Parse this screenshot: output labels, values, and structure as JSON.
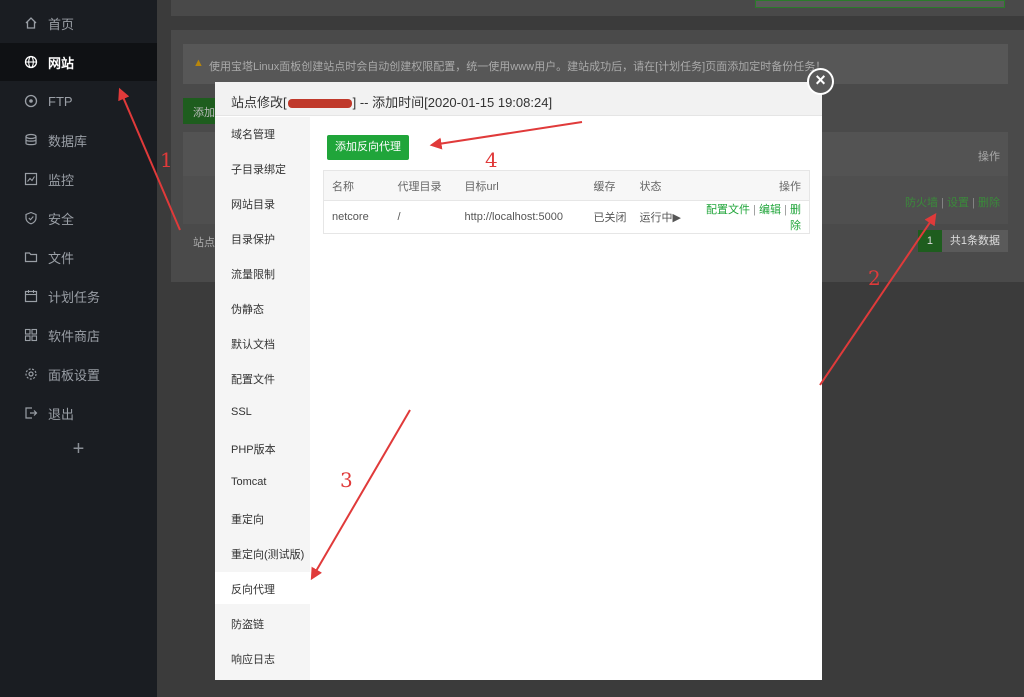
{
  "sidebar": {
    "items": [
      {
        "label": "首页",
        "icon": "home-icon"
      },
      {
        "label": "网站",
        "icon": "globe-icon",
        "active": true
      },
      {
        "label": "FTP",
        "icon": "ftp-icon"
      },
      {
        "label": "数据库",
        "icon": "database-icon"
      },
      {
        "label": "监控",
        "icon": "monitor-icon"
      },
      {
        "label": "安全",
        "icon": "shield-icon"
      },
      {
        "label": "文件",
        "icon": "folder-icon"
      },
      {
        "label": "计划任务",
        "icon": "calendar-icon"
      },
      {
        "label": "软件商店",
        "icon": "grid-icon"
      },
      {
        "label": "面板设置",
        "icon": "gear-icon"
      },
      {
        "label": "退出",
        "icon": "logout-icon"
      }
    ],
    "add_label": "+"
  },
  "background": {
    "warning_text": "使用宝塔Linux面板创建站点时会自动创建权限配置，统一使用www用户。建站成功后，请在[计划任务]页面添加定时备份任务！",
    "add_button": "添加",
    "table_header_op": "操作",
    "row_links": [
      "防火墙",
      "设置",
      "删除"
    ],
    "footer_label": "站点",
    "pager": {
      "page": "1",
      "count": "共1条数据"
    }
  },
  "modal": {
    "title_prefix": "站点修改[",
    "title_suffix": "] -- 添加时间[2020-01-15 19:08:24]",
    "close": "×",
    "nav": [
      "域名管理",
      "子目录绑定",
      "网站目录",
      "目录保护",
      "流量限制",
      "伪静态",
      "默认文档",
      "配置文件",
      "SSL",
      "PHP版本",
      "Tomcat",
      "重定向",
      "重定向(测试版)",
      "反向代理",
      "防盗链",
      "响应日志"
    ],
    "active_nav": "反向代理",
    "add_proxy_button": "添加反向代理",
    "table": {
      "headers": [
        "名称",
        "代理目录",
        "目标url",
        "缓存",
        "状态",
        "操作"
      ],
      "rows": [
        {
          "name": "netcore",
          "dir": "/",
          "url": "http://localhost:5000",
          "cache": "已关闭",
          "status": "运行中▶",
          "actions": [
            "配置文件",
            "编辑",
            "删除"
          ]
        }
      ]
    }
  },
  "annotations": [
    "1",
    "2",
    "3",
    "4"
  ],
  "colors": {
    "accent": "#20a53a",
    "annotation": "#e03a3a",
    "status_off": "#ef0808"
  }
}
